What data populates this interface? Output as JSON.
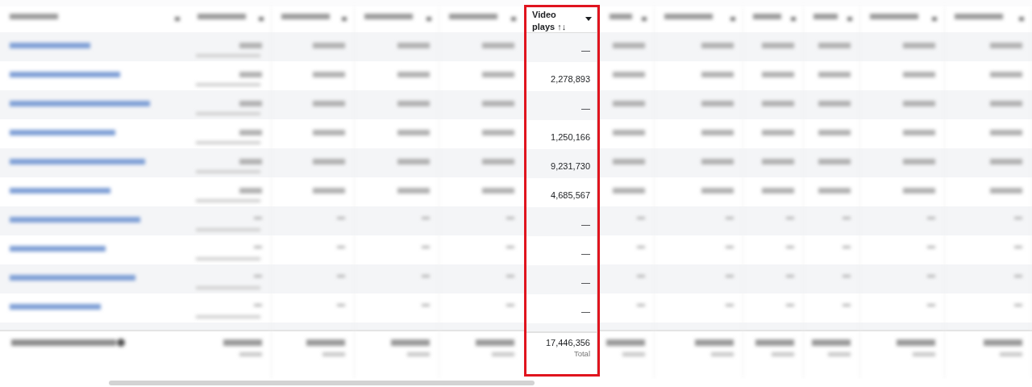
{
  "highlighted_column": {
    "header": "Video plays ↑↓",
    "rows": [
      {
        "value": "—"
      },
      {
        "value": "2,278,893"
      },
      {
        "value": "—"
      },
      {
        "value": "1,250,166"
      },
      {
        "value": "9,231,730"
      },
      {
        "value": "4,685,567"
      },
      {
        "value": "—"
      },
      {
        "value": "—"
      },
      {
        "value": "—"
      },
      {
        "value": "—"
      }
    ],
    "footer": {
      "value": "17,446,356",
      "label": "Total"
    }
  }
}
